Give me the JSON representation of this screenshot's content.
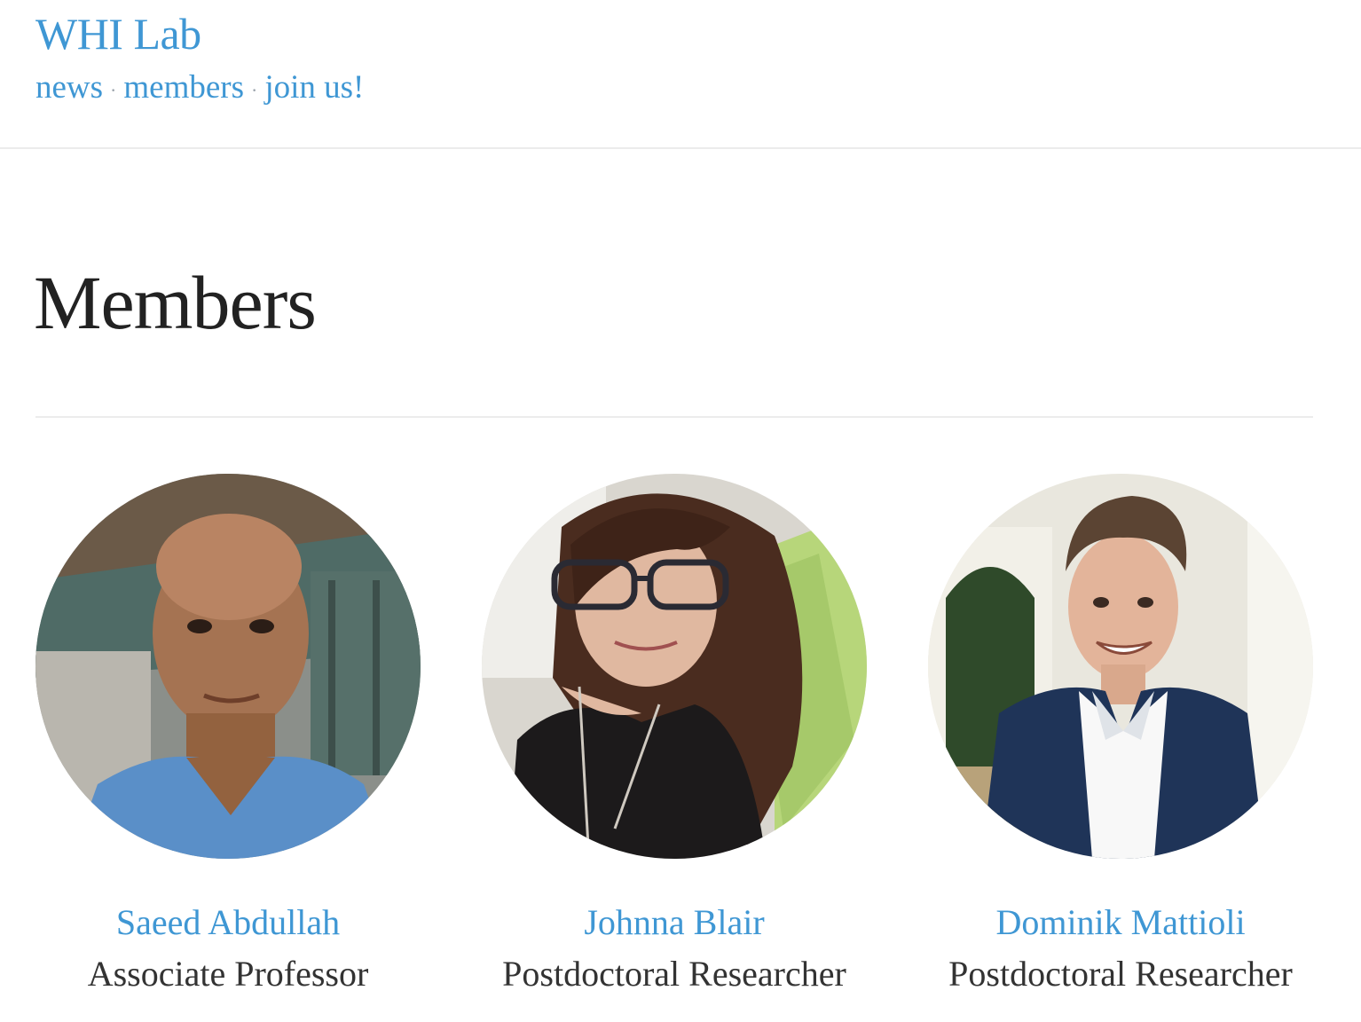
{
  "header": {
    "site_title": "WHI Lab",
    "nav": [
      {
        "label": "news"
      },
      {
        "label": "members"
      },
      {
        "label": "join us!"
      }
    ],
    "nav_separator": "·"
  },
  "page": {
    "title": "Members"
  },
  "members": [
    {
      "name": "Saeed Abdullah",
      "role": "Associate Professor"
    },
    {
      "name": "Johnna Blair",
      "role": "Postdoctoral Researcher"
    },
    {
      "name": "Dominik Mattioli",
      "role": "Postdoctoral Researcher"
    }
  ],
  "colors": {
    "link": "#3f97d4",
    "heading": "#222222",
    "text": "#333333",
    "divider": "#ececec"
  }
}
